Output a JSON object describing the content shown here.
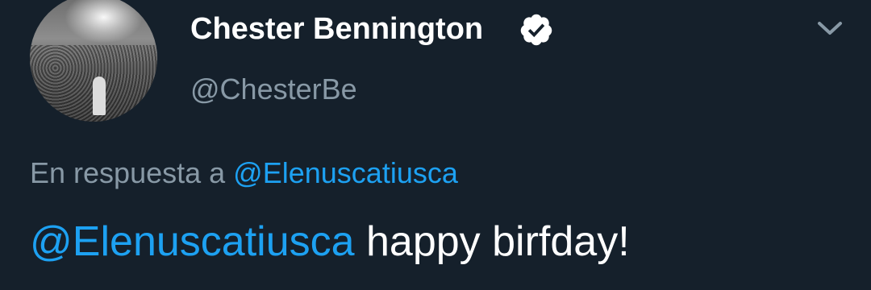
{
  "author": {
    "display_name": "Chester Bennington",
    "handle": "@ChesterBe",
    "verified": true,
    "avatar_icon": "concert-crowd-photo"
  },
  "reply": {
    "prefix": "En respuesta a",
    "mention": "@Elenuscatiusca"
  },
  "tweet": {
    "mention": "@Elenuscatiusca",
    "text": "happy birfday!"
  },
  "icons": {
    "verified": "verified-badge-icon",
    "menu": "chevron-down-icon"
  },
  "colors": {
    "background": "#15202b",
    "accent": "#1da1f2",
    "secondary_text": "#8899a6",
    "primary_text": "#ffffff"
  }
}
